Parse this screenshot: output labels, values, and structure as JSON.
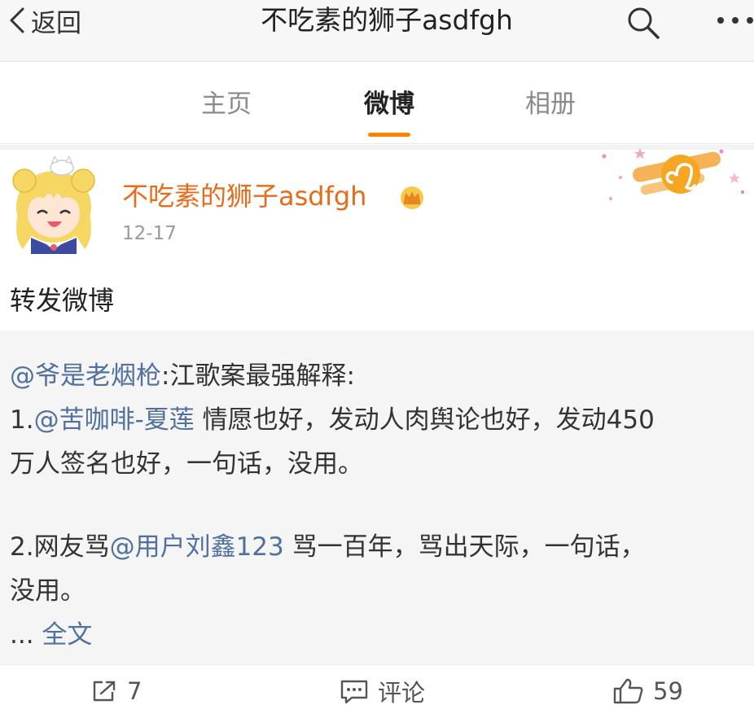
{
  "navbar": {
    "back_label": "返回",
    "title": "不吃素的狮子asdfgh"
  },
  "tabs": [
    {
      "label": "主页"
    },
    {
      "label": "微博"
    },
    {
      "label": "相册"
    }
  ],
  "post": {
    "author": "不吃素的狮子asdfgh",
    "date": "12-17",
    "text": "转发微博"
  },
  "repost": {
    "line1": {
      "mention": "@爷是老烟枪",
      "text": ":江歌案最强解释:"
    },
    "line2": {
      "prefix": "1.",
      "mention": "@苦咖啡-夏莲",
      "text": " 情愿也好，发动人肉舆论也好，发动450"
    },
    "line3": {
      "text": "万人签名也好，一句话，没用。"
    },
    "line4": {
      "prefix": "2.网友骂",
      "mention": "@用户刘鑫123",
      "text": " 骂一百年，骂出天际，一句话，"
    },
    "line5": {
      "text": "没用。"
    },
    "more": {
      "ellipsis": "... ",
      "label": "全文"
    }
  },
  "actions": {
    "repost_count": "7",
    "comment_label": "评论",
    "like_count": "59"
  },
  "colors": {
    "accent": "#ff8200",
    "author": "#e86b1a",
    "link": "#50719f"
  },
  "icons": [
    "back-chevron-icon",
    "search-icon",
    "more-icon",
    "vip-crown-icon",
    "leo-zodiac-icon",
    "repost-icon",
    "comment-icon",
    "like-icon"
  ]
}
